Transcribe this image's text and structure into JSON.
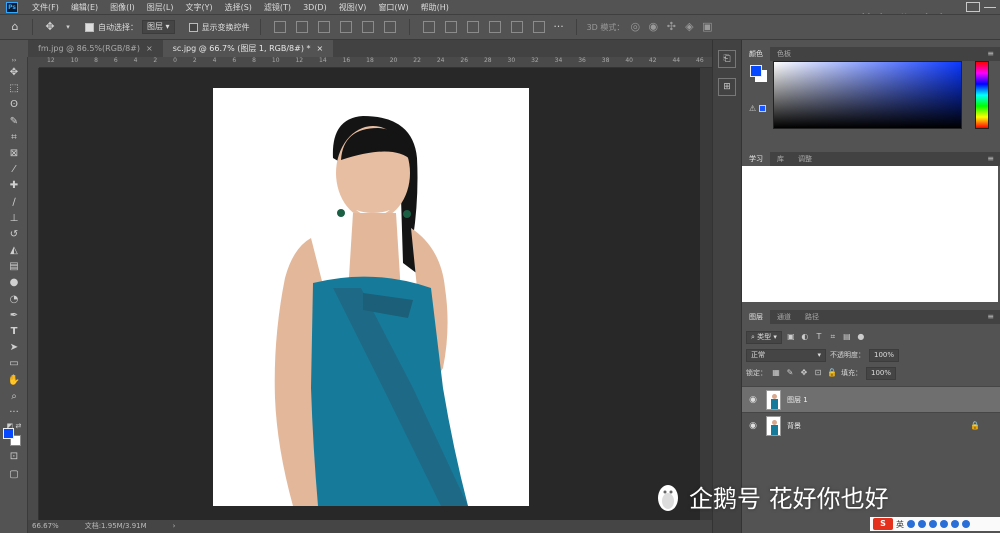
{
  "app": {
    "logo": "Ps"
  },
  "menu": [
    "文件(F)",
    "编辑(E)",
    "图像(I)",
    "图层(L)",
    "文字(Y)",
    "选择(S)",
    "滤镜(T)",
    "3D(D)",
    "视图(V)",
    "窗口(W)",
    "帮助(H)"
  ],
  "watermark_top": "花好你也好",
  "options": {
    "auto_select_label": "自动选择：",
    "auto_select_value": "图层",
    "show_transform_label": "显示变换控件",
    "mode_3d_label": "3D 模式："
  },
  "tabs": [
    {
      "label": "fm.jpg @ 86.5%(RGB/8#)",
      "active": false
    },
    {
      "label": "sc.jpg @ 66.7% (图层 1, RGB/8#) *",
      "active": true
    }
  ],
  "ruler_ticks": [
    "12",
    "10",
    "8",
    "6",
    "4",
    "2",
    "0",
    "2",
    "4",
    "6",
    "8",
    "10",
    "12",
    "14",
    "16",
    "18",
    "20",
    "22",
    "24",
    "26",
    "28",
    "30",
    "32",
    "34",
    "36",
    "38",
    "40",
    "42",
    "44",
    "46"
  ],
  "status": {
    "zoom": "66.67%",
    "doc": "文档:1.95M/3.91M"
  },
  "colors": {
    "foreground": "#0548ff",
    "background": "#ffffff",
    "dress": "#167a9b"
  },
  "color_panel": {
    "tabs": [
      "颜色",
      "色板"
    ]
  },
  "learn_panel": {
    "tabs": [
      "学习",
      "库",
      "调整"
    ]
  },
  "layers_panel": {
    "tabs": [
      "图层",
      "通道",
      "路径"
    ],
    "kind_filter": "类型",
    "blend_mode": "正常",
    "opacity_label": "不透明度：",
    "opacity_value": "100%",
    "lock_label": "锁定：",
    "fill_label": "填充：",
    "fill_value": "100%",
    "layers": [
      {
        "name": "图层 1",
        "selected": true,
        "locked": false
      },
      {
        "name": "背景",
        "selected": false,
        "locked": true
      }
    ]
  },
  "watermark_bottom": "企鹅号 花好你也好",
  "tray": {
    "ime": "英"
  }
}
